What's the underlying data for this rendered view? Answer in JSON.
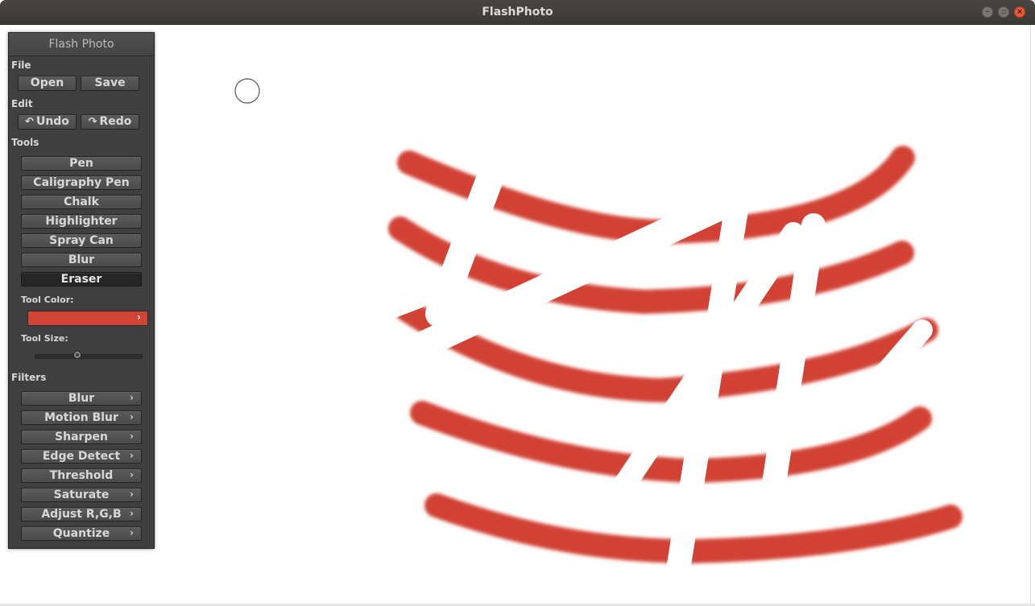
{
  "window": {
    "title": "FlashPhoto"
  },
  "panel": {
    "title": "Flash Photo",
    "sections": {
      "file": "File",
      "edit": "Edit",
      "tools": "Tools",
      "tool_color": "Tool Color:",
      "tool_size": "Tool Size:",
      "filters": "Filters"
    },
    "file_buttons": {
      "open": "Open",
      "save": "Save"
    },
    "edit_buttons": {
      "undo": "Undo",
      "redo": "Redo"
    },
    "tools": [
      "Pen",
      "Caligraphy Pen",
      "Chalk",
      "Highlighter",
      "Spray Can",
      "Blur",
      "Eraser"
    ],
    "active_tool": "Eraser",
    "tool_color": "#d14334",
    "tool_size_level": 0.4,
    "filters": [
      "Blur",
      "Motion Blur",
      "Sharpen",
      "Edge Detect",
      "Threshold",
      "Saturate",
      "Adjust R,G,B",
      "Quantize"
    ]
  },
  "icons": {
    "undo": "undo-arrow-icon",
    "redo": "redo-arrow-icon",
    "expand": "chevron-right-icon",
    "cursor": "eraser-cursor-circle-icon"
  },
  "colors": {
    "stroke": "#d14334",
    "panel_bg": "#3f3f3f",
    "canvas_bg": "#ffffff"
  }
}
